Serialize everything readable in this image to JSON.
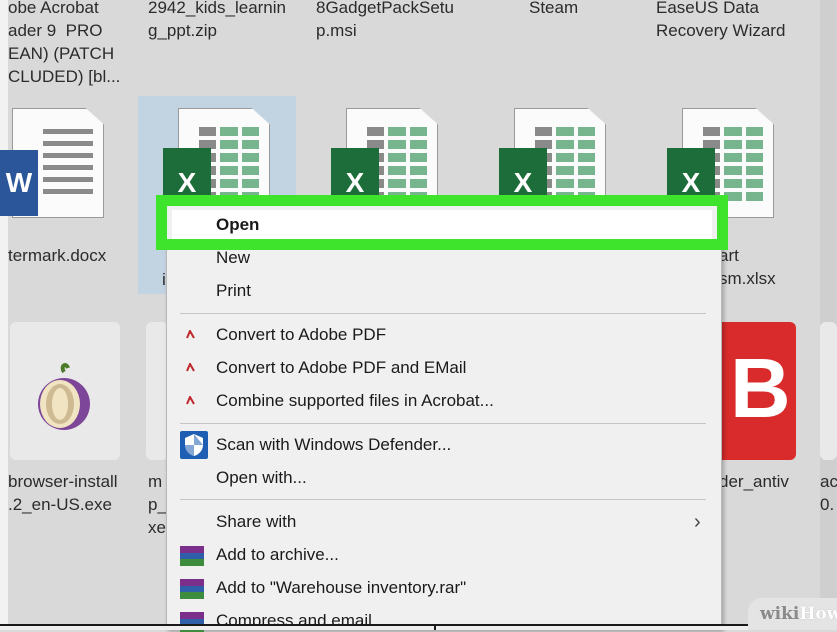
{
  "files_row1": [
    {
      "label": "obe Acrobat\nader 9  PRO\nEAN) (PATCH\nCLUDED) [bl..."
    },
    {
      "label": "2942_kids_learnin\ng_ppt.zip"
    },
    {
      "label": "8GadgetPackSetu\np.msi"
    },
    {
      "label": "Steam"
    },
    {
      "label": "EaseUS Data\nRecovery Wizard"
    }
  ],
  "files_row2": [
    {
      "label": "termark.docx",
      "badge": "W"
    },
    {
      "label": "i",
      "badge": "X"
    },
    {
      "label": "",
      "badge": "X"
    },
    {
      "label": "",
      "badge": "X"
    },
    {
      "label": "art\nsm.xlsx",
      "badge": "X"
    }
  ],
  "files_row3": [
    {
      "label": "browser-install\n.2_en-US.exe"
    },
    {
      "label": "m\np_\nxe"
    },
    {
      "label": "der_antiv"
    },
    {
      "label": "ac\n0."
    }
  ],
  "context_menu": {
    "items": [
      {
        "label": "Open"
      },
      {
        "label": "New"
      },
      {
        "label": "Print"
      },
      {
        "label": "Convert to Adobe PDF"
      },
      {
        "label": "Convert to Adobe PDF and EMail"
      },
      {
        "label": "Combine supported files in Acrobat..."
      },
      {
        "label": "Scan with Windows Defender..."
      },
      {
        "label": "Open with..."
      },
      {
        "label": "Share with"
      },
      {
        "label": "Add to archive..."
      },
      {
        "label": "Add to \"Warehouse inventory.rar\""
      },
      {
        "label": "Compress and email..."
      }
    ]
  },
  "icons": {
    "word": "word-doc-icon",
    "excel": "excel-doc-icon",
    "tor": "tor-onion-icon",
    "bitdefender": "bitdefender-icon",
    "adobe": "adobe-pdf-icon",
    "defender": "windows-defender-icon",
    "winrar": "winrar-icon"
  },
  "colors": {
    "highlight": "#3ee42c",
    "excel_green": "#1d6d3a",
    "word_blue": "#2b579a",
    "bitdefender_red": "#d92b2b"
  },
  "watermark": {
    "wiki": "wiki",
    "how": "How"
  }
}
